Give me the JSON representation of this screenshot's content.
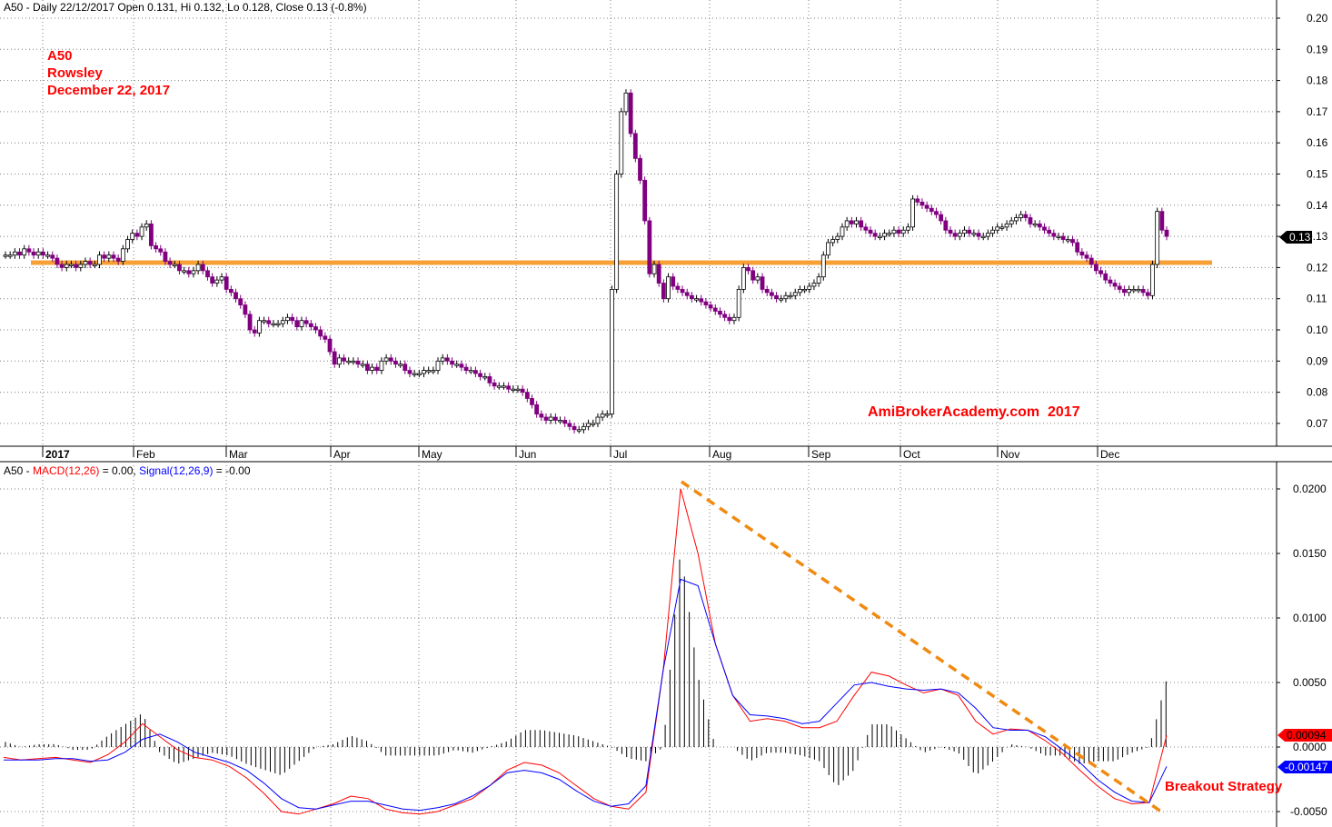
{
  "price_pane": {
    "header": "A50 - Daily 22/12/2017 Open 0.131, Hi 0.132, Lo 0.128, Close 0.13 (-0.8%)",
    "annotation_lines": [
      "A50",
      "Rowsley",
      "December 22, 2017"
    ],
    "watermark": "AmiBrokerAcademy.com  2017",
    "last_price_label": "0.13",
    "y_ticks": [
      "0.20",
      "0.19",
      "0.18",
      "0.17",
      "0.16",
      "0.15",
      "0.14",
      "0.13",
      "0.12",
      "0.11",
      "0.10",
      "0.09",
      "0.08",
      "0.07"
    ]
  },
  "x_axis": {
    "months": [
      "2017",
      "Feb",
      "Mar",
      "Apr",
      "May",
      "Jun",
      "Jul",
      "Aug",
      "Sep",
      "Oct",
      "Nov",
      "Dec"
    ]
  },
  "macd_pane": {
    "header_prefix": "A50 - ",
    "macd_label": "MACD(12,26)",
    "macd_value": " = 0.00, ",
    "signal_label": "Signal(12,26,9)",
    "signal_value": " = -0.00",
    "y_ticks": [
      "0.0200",
      "0.0150",
      "0.0100",
      "0.0050",
      "0.0000",
      "-0.0050"
    ],
    "macd_badge": "0.00094",
    "signal_badge": "-0.00147",
    "breakout_label": "Breakout Strategy"
  },
  "colors": {
    "candle": "#800080",
    "support_line": "#f7a035",
    "annotation": "#ff0000",
    "macd": "#ff0000",
    "signal": "#0000ff",
    "histogram": "#000000",
    "trendline": "#f08a10"
  },
  "chart_data": [
    {
      "type": "candlestick",
      "title": "A50 - Daily 22/12/2017",
      "ylim": [
        0.06,
        0.2
      ],
      "x": [
        "Jan",
        "Jan",
        "Jan",
        "Jan",
        "Jan",
        "Jan",
        "Jan",
        "Jan",
        "Jan",
        "Jan",
        "Jan",
        "Jan",
        "Jan",
        "Jan",
        "Jan",
        "Jan",
        "Jan",
        "Jan",
        "Jan",
        "Jan",
        "Feb",
        "Feb",
        "Feb",
        "Feb",
        "Feb",
        "Feb",
        "Feb",
        "Feb",
        "Feb",
        "Feb",
        "Feb",
        "Feb",
        "Feb",
        "Feb",
        "Feb",
        "Feb",
        "Feb",
        "Feb",
        "Feb",
        "Feb",
        "Mar",
        "Mar",
        "Mar",
        "Mar",
        "Mar",
        "Mar",
        "Mar",
        "Mar",
        "Mar",
        "Mar",
        "Mar",
        "Mar",
        "Mar",
        "Mar",
        "Mar",
        "Mar",
        "Mar",
        "Mar",
        "Mar",
        "Mar",
        "Mar",
        "Mar",
        "Mar",
        "Apr",
        "Apr",
        "Apr",
        "Apr",
        "Apr",
        "Apr",
        "Apr",
        "Apr",
        "Apr",
        "Apr",
        "Apr",
        "Apr",
        "Apr",
        "Apr",
        "Apr",
        "Apr",
        "Apr",
        "Apr",
        "Apr",
        "May",
        "May",
        "May",
        "May",
        "May",
        "May",
        "May",
        "May",
        "May",
        "May",
        "May",
        "May",
        "May",
        "May",
        "May",
        "May",
        "May",
        "May",
        "May",
        "May",
        "May",
        "Jun",
        "Jun",
        "Jun",
        "Jun",
        "Jun",
        "Jun",
        "Jun",
        "Jun",
        "Jun",
        "Jun",
        "Jun",
        "Jun",
        "Jun",
        "Jun",
        "Jun",
        "Jun",
        "Jun",
        "Jun",
        "Jun",
        "Jun",
        "Jun",
        "Jul",
        "Jul",
        "Jul",
        "Jul",
        "Jul",
        "Jul",
        "Jul",
        "Jul",
        "Jul",
        "Jul",
        "Jul",
        "Jul",
        "Jul",
        "Jul",
        "Jul",
        "Jul",
        "Jul",
        "Jul",
        "Jul",
        "Jul",
        "Jul",
        "Aug",
        "Aug",
        "Aug",
        "Aug",
        "Aug",
        "Aug",
        "Aug",
        "Aug",
        "Aug",
        "Aug",
        "Aug",
        "Aug",
        "Aug",
        "Aug",
        "Aug",
        "Aug",
        "Aug",
        "Aug",
        "Aug",
        "Aug",
        "Aug",
        "Aug",
        "Sep",
        "Sep",
        "Sep",
        "Sep",
        "Sep",
        "Sep",
        "Sep",
        "Sep",
        "Sep",
        "Sep",
        "Sep",
        "Sep",
        "Sep",
        "Sep",
        "Sep",
        "Sep",
        "Sep",
        "Sep",
        "Sep",
        "Sep",
        "Oct",
        "Oct",
        "Oct",
        "Oct",
        "Oct",
        "Oct",
        "Oct",
        "Oct",
        "Oct",
        "Oct",
        "Oct",
        "Oct",
        "Oct",
        "Oct",
        "Oct",
        "Oct",
        "Oct",
        "Oct",
        "Oct",
        "Oct",
        "Oct",
        "Oct",
        "Nov",
        "Nov",
        "Nov",
        "Nov",
        "Nov",
        "Nov",
        "Nov",
        "Nov",
        "Nov",
        "Nov",
        "Nov",
        "Nov",
        "Nov",
        "Nov",
        "Nov",
        "Nov",
        "Nov",
        "Nov",
        "Nov",
        "Nov",
        "Nov",
        "Nov",
        "Dec",
        "Dec",
        "Dec",
        "Dec",
        "Dec",
        "Dec",
        "Dec",
        "Dec",
        "Dec",
        "Dec",
        "Dec",
        "Dec",
        "Dec",
        "Dec",
        "Dec",
        "Dec"
      ],
      "close": [
        0.124,
        0.124,
        0.125,
        0.124,
        0.126,
        0.125,
        0.124,
        0.125,
        0.124,
        0.124,
        0.123,
        0.121,
        0.12,
        0.121,
        0.121,
        0.12,
        0.121,
        0.122,
        0.121,
        0.121,
        0.124,
        0.123,
        0.124,
        0.123,
        0.122,
        0.126,
        0.129,
        0.131,
        0.13,
        0.133,
        0.134,
        0.127,
        0.126,
        0.125,
        0.122,
        0.121,
        0.121,
        0.119,
        0.119,
        0.118,
        0.119,
        0.121,
        0.119,
        0.117,
        0.115,
        0.116,
        0.117,
        0.113,
        0.112,
        0.11,
        0.108,
        0.105,
        0.1,
        0.099,
        0.103,
        0.103,
        0.102,
        0.102,
        0.102,
        0.103,
        0.104,
        0.103,
        0.101,
        0.103,
        0.102,
        0.101,
        0.1,
        0.098,
        0.097,
        0.093,
        0.089,
        0.091,
        0.09,
        0.09,
        0.09,
        0.089,
        0.089,
        0.087,
        0.088,
        0.087,
        0.09,
        0.091,
        0.09,
        0.089,
        0.089,
        0.087,
        0.086,
        0.086,
        0.086,
        0.087,
        0.087,
        0.087,
        0.09,
        0.091,
        0.09,
        0.089,
        0.089,
        0.088,
        0.087,
        0.087,
        0.086,
        0.085,
        0.085,
        0.083,
        0.082,
        0.082,
        0.082,
        0.081,
        0.081,
        0.081,
        0.08,
        0.078,
        0.076,
        0.073,
        0.072,
        0.071,
        0.072,
        0.071,
        0.071,
        0.07,
        0.069,
        0.068,
        0.068,
        0.069,
        0.07,
        0.07,
        0.072,
        0.073,
        0.073,
        0.113,
        0.15,
        0.17,
        0.176,
        0.163,
        0.155,
        0.148,
        0.135,
        0.118,
        0.121,
        0.115,
        0.11,
        0.117,
        0.114,
        0.113,
        0.112,
        0.111,
        0.11,
        0.11,
        0.109,
        0.108,
        0.107,
        0.106,
        0.105,
        0.104,
        0.103,
        0.104,
        0.113,
        0.12,
        0.119,
        0.116,
        0.117,
        0.113,
        0.112,
        0.111,
        0.11,
        0.11,
        0.111,
        0.111,
        0.112,
        0.113,
        0.113,
        0.114,
        0.115,
        0.117,
        0.124,
        0.128,
        0.129,
        0.13,
        0.133,
        0.135,
        0.134,
        0.135,
        0.133,
        0.132,
        0.131,
        0.13,
        0.13,
        0.131,
        0.131,
        0.132,
        0.131,
        0.132,
        0.133,
        0.142,
        0.141,
        0.14,
        0.139,
        0.138,
        0.137,
        0.135,
        0.132,
        0.131,
        0.13,
        0.131,
        0.132,
        0.131,
        0.131,
        0.13,
        0.13,
        0.131,
        0.132,
        0.133,
        0.133,
        0.134,
        0.135,
        0.136,
        0.137,
        0.136,
        0.134,
        0.134,
        0.133,
        0.132,
        0.131,
        0.13,
        0.13,
        0.129,
        0.129,
        0.128,
        0.125,
        0.124,
        0.123,
        0.121,
        0.119,
        0.118,
        0.116,
        0.115,
        0.114,
        0.113,
        0.112,
        0.113,
        0.113,
        0.113,
        0.112,
        0.111,
        0.121,
        0.138,
        0.132,
        0.13
      ]
    },
    {
      "type": "line",
      "title": "MACD(12,26) / Signal(12,26,9)",
      "ylim": [
        -0.006,
        0.021
      ],
      "series": [
        {
          "name": "MACD(12,26)",
          "values": [
            -0.0008,
            -0.001,
            -0.0009,
            -0.0008,
            -0.001,
            -0.0012,
            -0.0006,
            0.0004,
            0.0018,
            0.0008,
            -0.0002,
            -0.0008,
            -0.001,
            -0.0015,
            -0.0024,
            -0.0036,
            -0.005,
            -0.0052,
            -0.0048,
            -0.0044,
            -0.0038,
            -0.004,
            -0.0048,
            -0.0051,
            -0.0052,
            -0.005,
            -0.0045,
            -0.004,
            -0.003,
            -0.0018,
            -0.0012,
            -0.0014,
            -0.002,
            -0.003,
            -0.004,
            -0.0046,
            -0.0048,
            -0.0035,
            0.006,
            0.02,
            0.015,
            0.008,
            0.004,
            0.002,
            0.0022,
            0.002,
            0.0015,
            0.0015,
            0.002,
            0.004,
            0.0058,
            0.0055,
            0.0048,
            0.0042,
            0.0045,
            0.004,
            0.002,
            0.001,
            0.0014,
            0.0013,
            0.0005,
            -0.0005,
            -0.0018,
            -0.003,
            -0.004,
            -0.0044,
            -0.0043,
            0.0009
          ]
        },
        {
          "name": "Signal(12,26,9)",
          "values": [
            -0.001,
            -0.001,
            -0.001,
            -0.0009,
            -0.0009,
            -0.0011,
            -0.001,
            -0.0004,
            0.0006,
            0.001,
            0.0004,
            -0.0004,
            -0.0008,
            -0.0012,
            -0.0018,
            -0.0028,
            -0.004,
            -0.0047,
            -0.0048,
            -0.0045,
            -0.0042,
            -0.0042,
            -0.0045,
            -0.0048,
            -0.0049,
            -0.0047,
            -0.0044,
            -0.0038,
            -0.003,
            -0.002,
            -0.0018,
            -0.002,
            -0.0025,
            -0.0034,
            -0.0042,
            -0.0046,
            -0.0044,
            -0.003,
            0.006,
            0.013,
            0.0125,
            0.008,
            0.004,
            0.0025,
            0.0024,
            0.0022,
            0.0018,
            0.002,
            0.0034,
            0.0048,
            0.005,
            0.0047,
            0.0045,
            0.0044,
            0.0045,
            0.0042,
            0.003,
            0.0015,
            0.0013,
            0.0013,
            0.0008,
            -0.0002,
            -0.0012,
            -0.0025,
            -0.0035,
            -0.0042,
            -0.0043,
            -0.0015
          ]
        }
      ]
    }
  ]
}
